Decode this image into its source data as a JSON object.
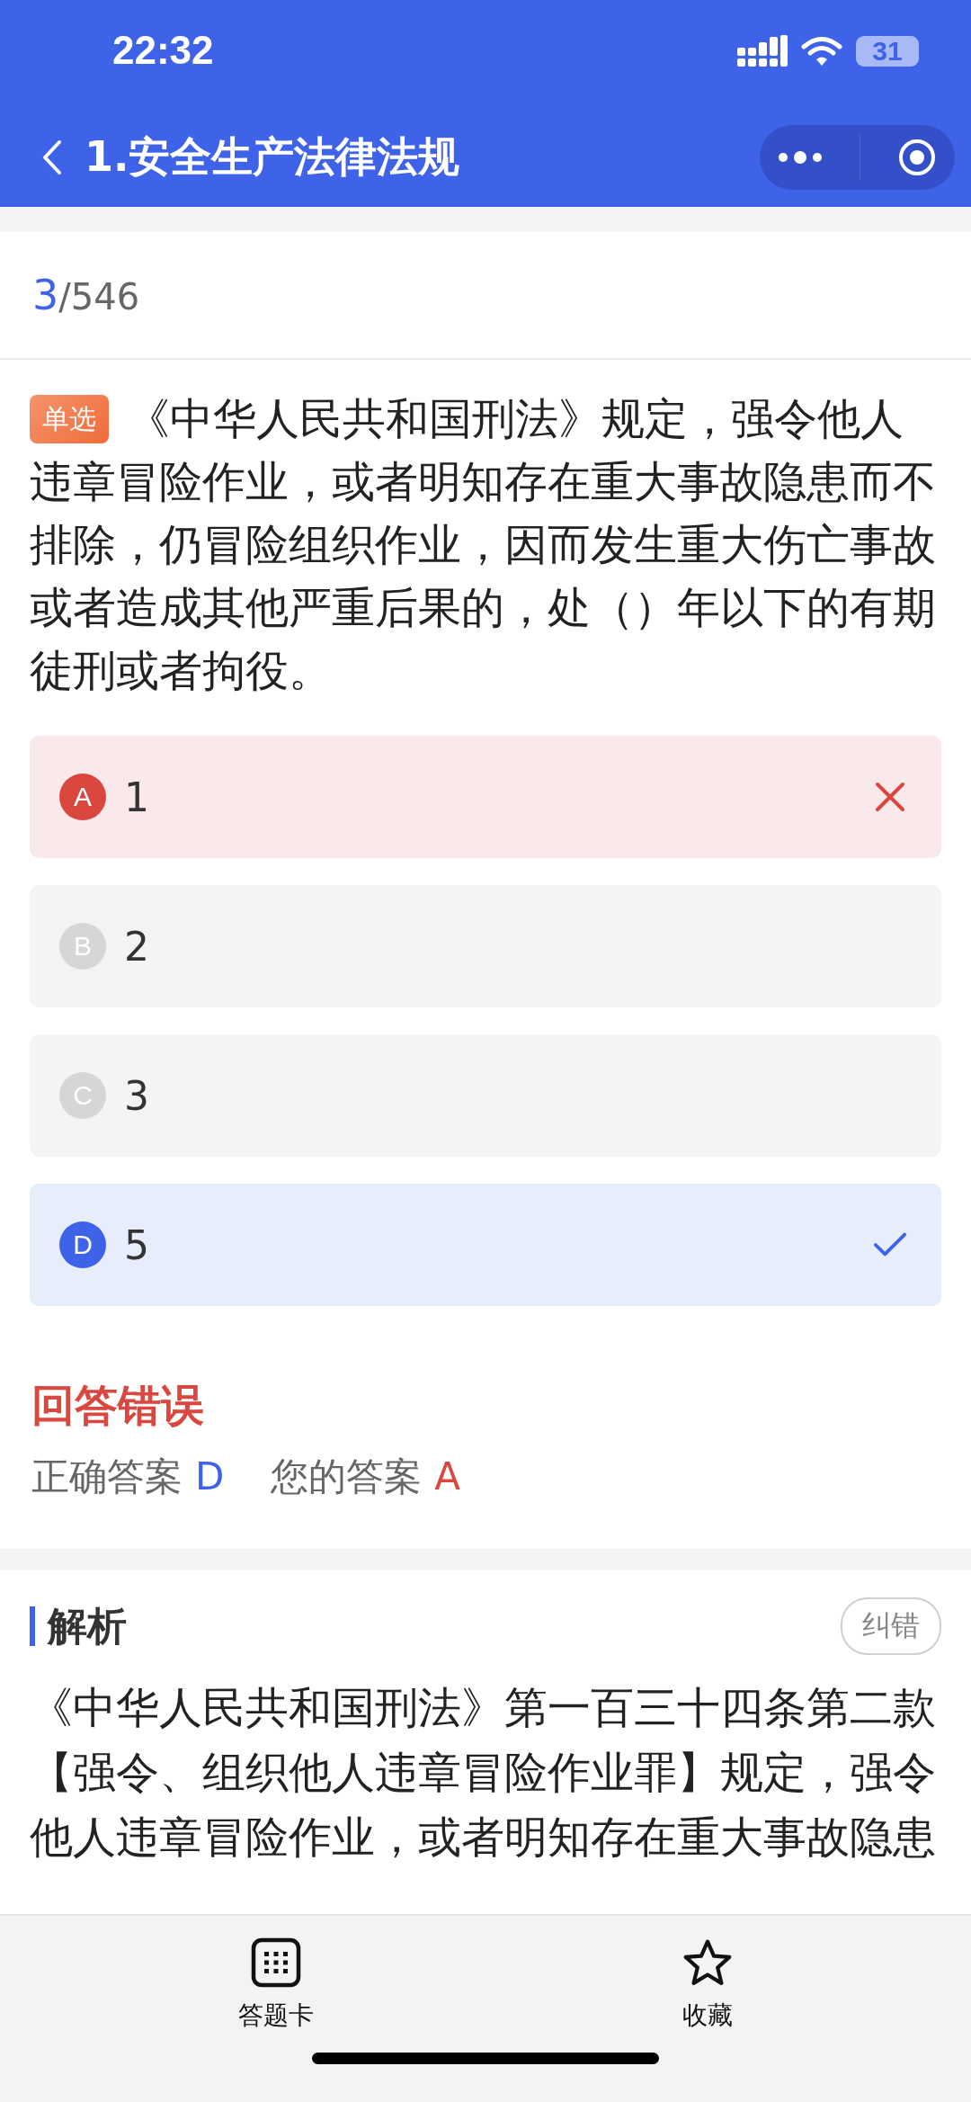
{
  "status_bar": {
    "time": "22:32",
    "battery": "31"
  },
  "nav": {
    "title": "1.安全生产法律法规"
  },
  "counter": {
    "current": "3",
    "total": "/546"
  },
  "question": {
    "type_badge": "单选",
    "text": "《中华人民共和国刑法》规定，强令他人违章冒险作业，或者明知存在重大事故隐患而不排除，仍冒险组织作业，因而发生重大伤亡事故或者造成其他严重后果的，处（）年以下的有期徒刑或者拘役。"
  },
  "options": [
    {
      "letter": "A",
      "text": "1",
      "selected": true,
      "correct": false
    },
    {
      "letter": "B",
      "text": "2",
      "selected": false,
      "correct": false
    },
    {
      "letter": "C",
      "text": "3",
      "selected": false,
      "correct": false
    },
    {
      "letter": "D",
      "text": "5",
      "selected": false,
      "correct": true
    }
  ],
  "result": {
    "title": "回答错误",
    "correct_label": "正确答案",
    "correct_answer": "D",
    "your_label": "您的答案",
    "your_answer": "A"
  },
  "analysis": {
    "title": "解析",
    "report_button": "纠错",
    "text": "《中华人民共和国刑法》第一百三十四条第二款【强令、组织他人违章冒险作业罪】规定，强令他人违章冒险作业，或者明知存在重大事故隐患"
  },
  "bottom_bar": [
    {
      "kind": "grid",
      "label": "答题卡"
    },
    {
      "kind": "star",
      "label": "收藏"
    }
  ]
}
